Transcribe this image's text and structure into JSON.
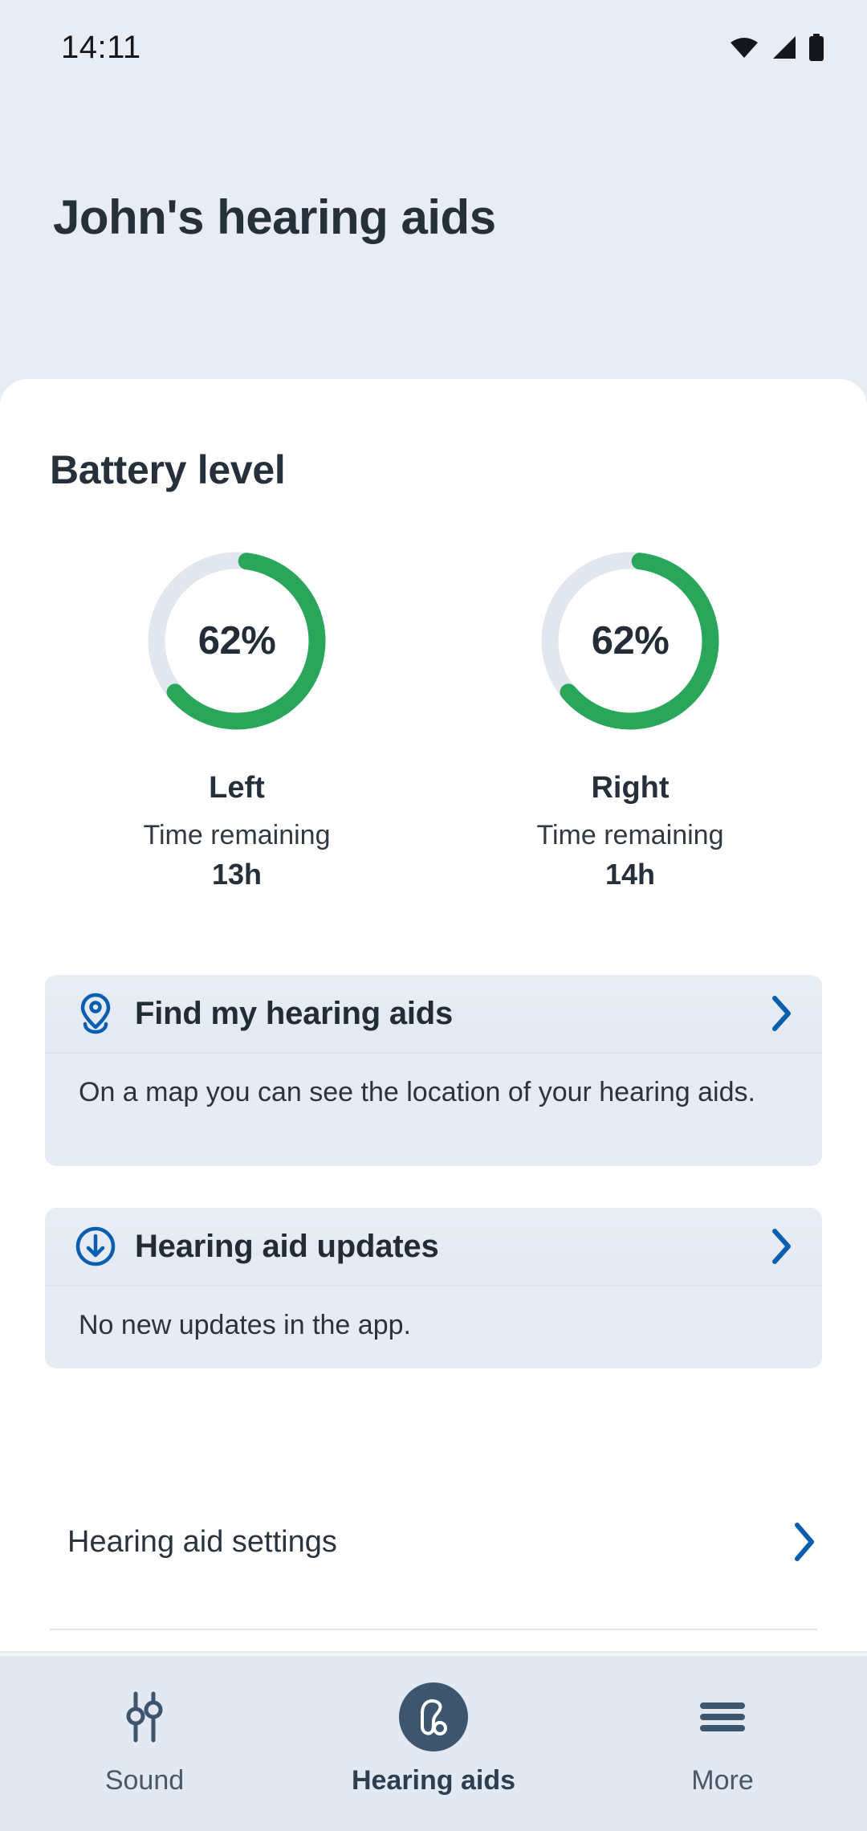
{
  "status_bar": {
    "time": "14:11",
    "icons": [
      "wifi-icon",
      "cellular-signal-icon",
      "battery-icon"
    ]
  },
  "header": {
    "title": "John's hearing aids"
  },
  "battery_section": {
    "title": "Battery level",
    "gauges": [
      {
        "percent_label": "62%",
        "percent_value": 62,
        "side_label": "Left",
        "time_caption": "Time remaining",
        "time_value": "13h"
      },
      {
        "percent_label": "62%",
        "percent_value": 62,
        "side_label": "Right",
        "time_caption": "Time remaining",
        "time_value": "14h"
      }
    ],
    "track_color": "#e2e7ef",
    "fill_color": "#2aa65a"
  },
  "info_cards": [
    {
      "icon": "location-pin-icon",
      "title": "Find my hearing aids",
      "body": "On a map you can see the location of your hearing aids.",
      "chevron": "chevron-right-icon"
    },
    {
      "icon": "download-circle-icon",
      "title": "Hearing aid updates",
      "body": "No new updates in the app.",
      "chevron": "chevron-right-icon"
    }
  ],
  "settings_row": {
    "label": "Hearing aid settings",
    "chevron": "chevron-right-icon"
  },
  "bottom_nav": {
    "items": [
      {
        "label": "Sound",
        "icon": "sliders-icon",
        "active": false
      },
      {
        "label": "Hearing aids",
        "icon": "hearing-aid-icon",
        "active": true
      },
      {
        "label": "More",
        "icon": "hamburger-menu-icon",
        "active": false
      }
    ]
  },
  "colors": {
    "page_background": "#e8ecf4",
    "card_background": "#ffffff",
    "accent_blue": "#0a5eb0",
    "accent_green": "#2aa65a",
    "text_dark": "#25303b",
    "nav_active": "#3d566e"
  }
}
